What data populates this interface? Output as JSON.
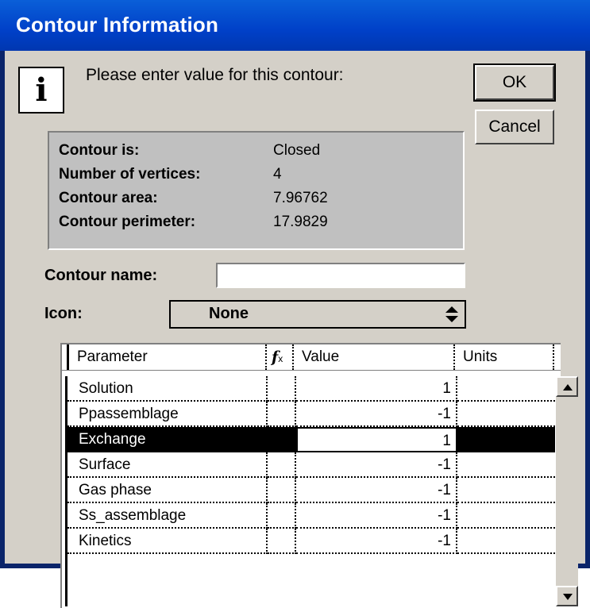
{
  "window": {
    "title": "Contour Information"
  },
  "prompt": {
    "text": "Please enter value for this contour:"
  },
  "buttons": {
    "ok": "OK",
    "cancel": "Cancel"
  },
  "info": {
    "rows": [
      {
        "label": "Contour is:",
        "value": "Closed"
      },
      {
        "label": "Number of vertices:",
        "value": "4"
      },
      {
        "label": "Contour area:",
        "value": "7.96762"
      },
      {
        "label": "Contour perimeter:",
        "value": "17.9829"
      }
    ]
  },
  "form": {
    "contour_name_label": "Contour name:",
    "contour_name_value": "",
    "icon_label": "Icon:",
    "icon_value": "None"
  },
  "table": {
    "headers": {
      "parameter": "Parameter",
      "value": "Value",
      "units": "Units"
    },
    "rows": [
      {
        "parameter": "Solution",
        "value": "1",
        "units": ""
      },
      {
        "parameter": "Ppassemblage",
        "value": "-1",
        "units": ""
      },
      {
        "parameter": "Exchange",
        "value": "1",
        "units": "",
        "selected": true
      },
      {
        "parameter": "Surface",
        "value": "-1",
        "units": ""
      },
      {
        "parameter": "Gas phase",
        "value": "-1",
        "units": ""
      },
      {
        "parameter": "Ss_assemblage",
        "value": "-1",
        "units": ""
      },
      {
        "parameter": "Kinetics",
        "value": "-1",
        "units": ""
      }
    ]
  },
  "icons": {
    "info": "info-icon",
    "fx": "function-icon",
    "popup": "up-down-arrows-icon",
    "scroll_up": "scroll-up-arrow-icon",
    "scroll_down": "scroll-down-arrow-icon"
  },
  "colors": {
    "titlebar": "#0040c8",
    "dialog_bg": "#d4d0c8",
    "selection": "#000000"
  }
}
